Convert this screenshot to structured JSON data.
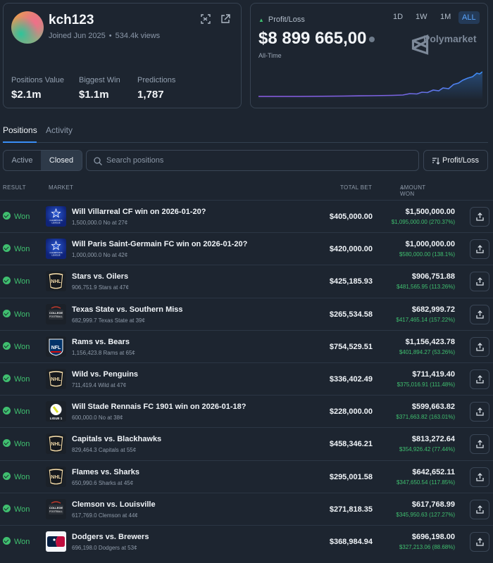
{
  "profile": {
    "username": "kch123",
    "joined": "Joined Jun 2025",
    "views": "534.4k views",
    "stats": [
      {
        "label": "Positions Value",
        "value": "$2.1m"
      },
      {
        "label": "Biggest Win",
        "value": "$1.1m"
      },
      {
        "label": "Predictions",
        "value": "1,787"
      }
    ]
  },
  "pnl": {
    "label": "Profit/Loss",
    "value": "$8 899 665,00",
    "period": "All-Time",
    "brand": "Polymarket",
    "ranges": [
      "1D",
      "1W",
      "1M",
      "ALL"
    ],
    "selected_range": "ALL"
  },
  "tabs": [
    "Positions",
    "Activity"
  ],
  "filters": {
    "status_options": [
      "Active",
      "Closed"
    ],
    "selected_status": "Closed",
    "search_placeholder": "Search positions",
    "sort_label": "Profit/Loss"
  },
  "table": {
    "headers": {
      "result": "RESULT",
      "market": "MARKET",
      "total_bet": "TOTAL BET",
      "amount_won": "AMOUNT WON"
    },
    "rows": [
      {
        "result": "Won",
        "logo": "ucl",
        "title": "Will Villarreal CF win on 2026-01-20?",
        "sub": "1,500,000.0 No at 27¢",
        "total": "$405,000.00",
        "amount": "$1,500,000.00",
        "gain": "$1,095,000.00 (270.37%)"
      },
      {
        "result": "Won",
        "logo": "ucl",
        "title": "Will Paris Saint-Germain FC win on 2026-01-20?",
        "sub": "1,000,000.0 No at 42¢",
        "total": "$420,000.00",
        "amount": "$1,000,000.00",
        "gain": "$580,000.00 (138.1%)"
      },
      {
        "result": "Won",
        "logo": "nhl",
        "title": "Stars vs. Oilers",
        "sub": "906,751.9 Stars at 47¢",
        "total": "$425,185.93",
        "amount": "$906,751.88",
        "gain": "$481,565.95 (113.26%)"
      },
      {
        "result": "Won",
        "logo": "cfb",
        "title": "Texas State vs. Southern Miss",
        "sub": "682,999.7 Texas State at 39¢",
        "total": "$265,534.58",
        "amount": "$682,999.72",
        "gain": "$417,465.14 (157.22%)"
      },
      {
        "result": "Won",
        "logo": "nfl",
        "title": "Rams vs. Bears",
        "sub": "1,156,423.8 Rams at 65¢",
        "total": "$754,529.51",
        "amount": "$1,156,423.78",
        "gain": "$401,894.27 (53.26%)"
      },
      {
        "result": "Won",
        "logo": "nhl",
        "title": "Wild vs. Penguins",
        "sub": "711,419.4 Wild at 47¢",
        "total": "$336,402.49",
        "amount": "$711,419.40",
        "gain": "$375,016.91 (111.48%)"
      },
      {
        "result": "Won",
        "logo": "l1",
        "title": "Will Stade Rennais FC 1901 win on 2026-01-18?",
        "sub": "600,000.0 No at 38¢",
        "total": "$228,000.00",
        "amount": "$599,663.82",
        "gain": "$371,663.82 (163.01%)"
      },
      {
        "result": "Won",
        "logo": "nhl",
        "title": "Capitals vs. Blackhawks",
        "sub": "829,464.3 Capitals at 55¢",
        "total": "$458,346.21",
        "amount": "$813,272.64",
        "gain": "$354,926.42 (77.44%)"
      },
      {
        "result": "Won",
        "logo": "nhl",
        "title": "Flames vs. Sharks",
        "sub": "650,990.6 Sharks at 45¢",
        "total": "$295,001.58",
        "amount": "$642,652.11",
        "gain": "$347,650.54 (117.85%)"
      },
      {
        "result": "Won",
        "logo": "cfb",
        "title": "Clemson vs. Louisville",
        "sub": "617,769.0 Clemson at 44¢",
        "total": "$271,818.35",
        "amount": "$617,768.99",
        "gain": "$345,950.63 (127.27%)"
      },
      {
        "result": "Won",
        "logo": "mlb",
        "title": "Dodgers vs. Brewers",
        "sub": "696,198.0 Dodgers at 53¢",
        "total": "$368,984.94",
        "amount": "$696,198.00",
        "gain": "$327,213.06 (88.68%)"
      }
    ]
  }
}
